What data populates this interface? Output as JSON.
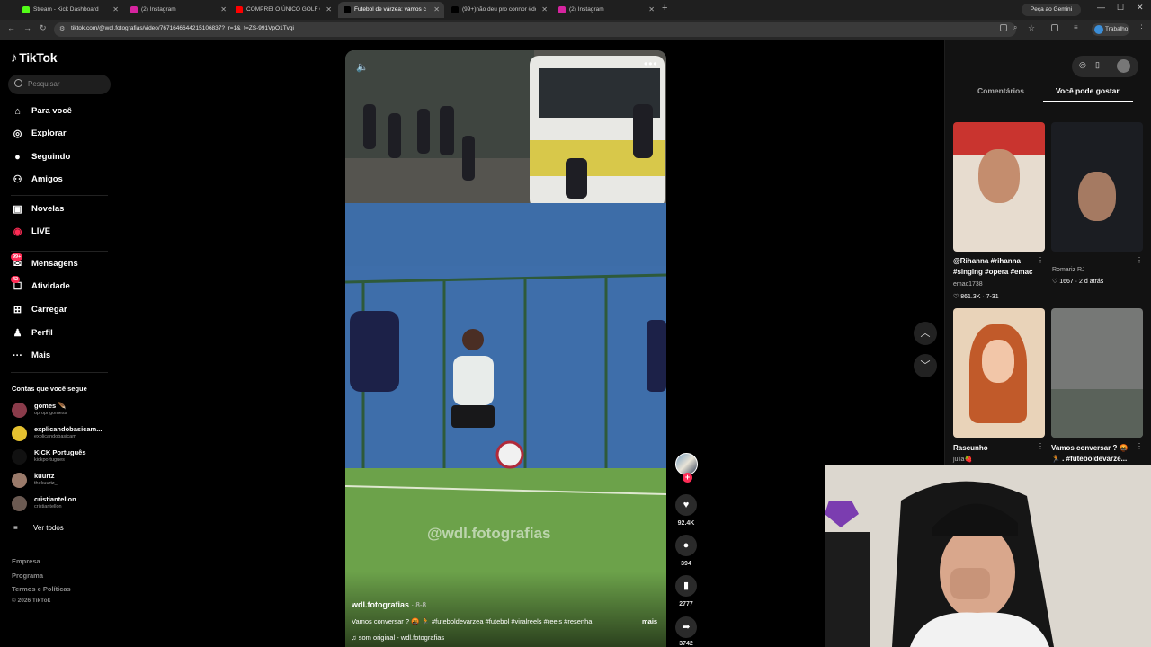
{
  "browser": {
    "tabs": [
      {
        "title": "Stream - Kick Dashboard",
        "favicon_color": "#53fc18"
      },
      {
        "title": "(2) Instagram",
        "favicon_color": "#d6249f"
      },
      {
        "title": "COMPREI O ÚNICO GOLF GTI A",
        "favicon_color": "#ff0000"
      },
      {
        "title": "Futebol de várzea: vamos c",
        "favicon_color": "#000000"
      },
      {
        "title": "(99+)não deu pro connor #dom",
        "favicon_color": "#000000"
      },
      {
        "title": "(2) Instagram",
        "favicon_color": "#d6249f"
      }
    ],
    "active_tab": 3,
    "new_tab": "+",
    "gemini_label": "Peça ao Gemini",
    "url": "tiktok.com/@wdl.fotografias/video/7671646644215106837?_r=1&_t=ZS-991VpO1Tvqi",
    "profile_label": "Trabalho"
  },
  "sidebar": {
    "logo": "TikTok",
    "search_placeholder": "Pesquisar",
    "nav": [
      {
        "label": "Para você",
        "icon": "home-icon",
        "glyph": "⌂"
      },
      {
        "label": "Explorar",
        "icon": "compass-icon",
        "glyph": "◎"
      },
      {
        "label": "Seguindo",
        "icon": "following-avatar-icon",
        "glyph": "●"
      },
      {
        "label": "Amigos",
        "icon": "friends-icon",
        "glyph": "⚇"
      },
      {
        "label": "Novelas",
        "icon": "series-icon",
        "glyph": "▣"
      },
      {
        "label": "LIVE",
        "icon": "live-icon",
        "glyph": "◉"
      },
      {
        "label": "Mensagens",
        "icon": "messages-icon",
        "glyph": "✉",
        "badge": "99+"
      },
      {
        "label": "Atividade",
        "icon": "activity-icon",
        "glyph": "☐",
        "badge": "42"
      },
      {
        "label": "Carregar",
        "icon": "upload-icon",
        "glyph": "⊞"
      },
      {
        "label": "Perfil",
        "icon": "profile-icon",
        "glyph": "♟"
      },
      {
        "label": "Mais",
        "icon": "more-icon",
        "glyph": "···"
      }
    ],
    "following_heading": "Contas que você segue",
    "accounts": [
      {
        "name": "gomes 🪶",
        "handle": "oproprigomess",
        "color": "#8a3b4a"
      },
      {
        "name": "explicandobasicam...",
        "handle": "explicandobasicam",
        "color": "#e5c130"
      },
      {
        "name": "KICK Português",
        "handle": "kickportugues",
        "color": "#111111"
      },
      {
        "name": "kuurtz",
        "handle": "thekuurtz_",
        "color": "#9a7a6a"
      },
      {
        "name": "cristiantellon",
        "handle": "cristiantellon",
        "color": "#6b5a52"
      }
    ],
    "see_all": "Ver todos",
    "footer": [
      "Empresa",
      "Programa",
      "Termos e Políticas",
      "© 2026 TikTok"
    ]
  },
  "video": {
    "watermark": "@wdl.fotografias",
    "author": "wdl.fotografias",
    "date": "· 8-8",
    "description": "Vamos conversar ? 🤬 🏃 #futeboldevarzea #futebol #viralreels #reels #resenha",
    "more": "mais",
    "music": "♫  som original - wdl.fotografias"
  },
  "actions": {
    "likes": "92.4K",
    "comments": "394",
    "saves": "2777",
    "shares": "3742"
  },
  "right_panel": {
    "tabs": [
      "Comentários",
      "Você pode gostar"
    ],
    "suggestions": [
      {
        "caption": "@Rihanna #rihanna #singing #opera #emac",
        "author": "emac1738",
        "stats": "♡ 861.3K · 7-31"
      },
      {
        "caption": "",
        "author": "Romariz RJ",
        "stats": "♡ 1667 · 2 d atrás"
      },
      {
        "caption": "Rascunho",
        "author": "julia🍓",
        "stats": ""
      },
      {
        "caption": "Vamos conversar ? 🤬 🏃 . #futeboldevarze...",
        "author": "",
        "stats": ""
      }
    ]
  }
}
